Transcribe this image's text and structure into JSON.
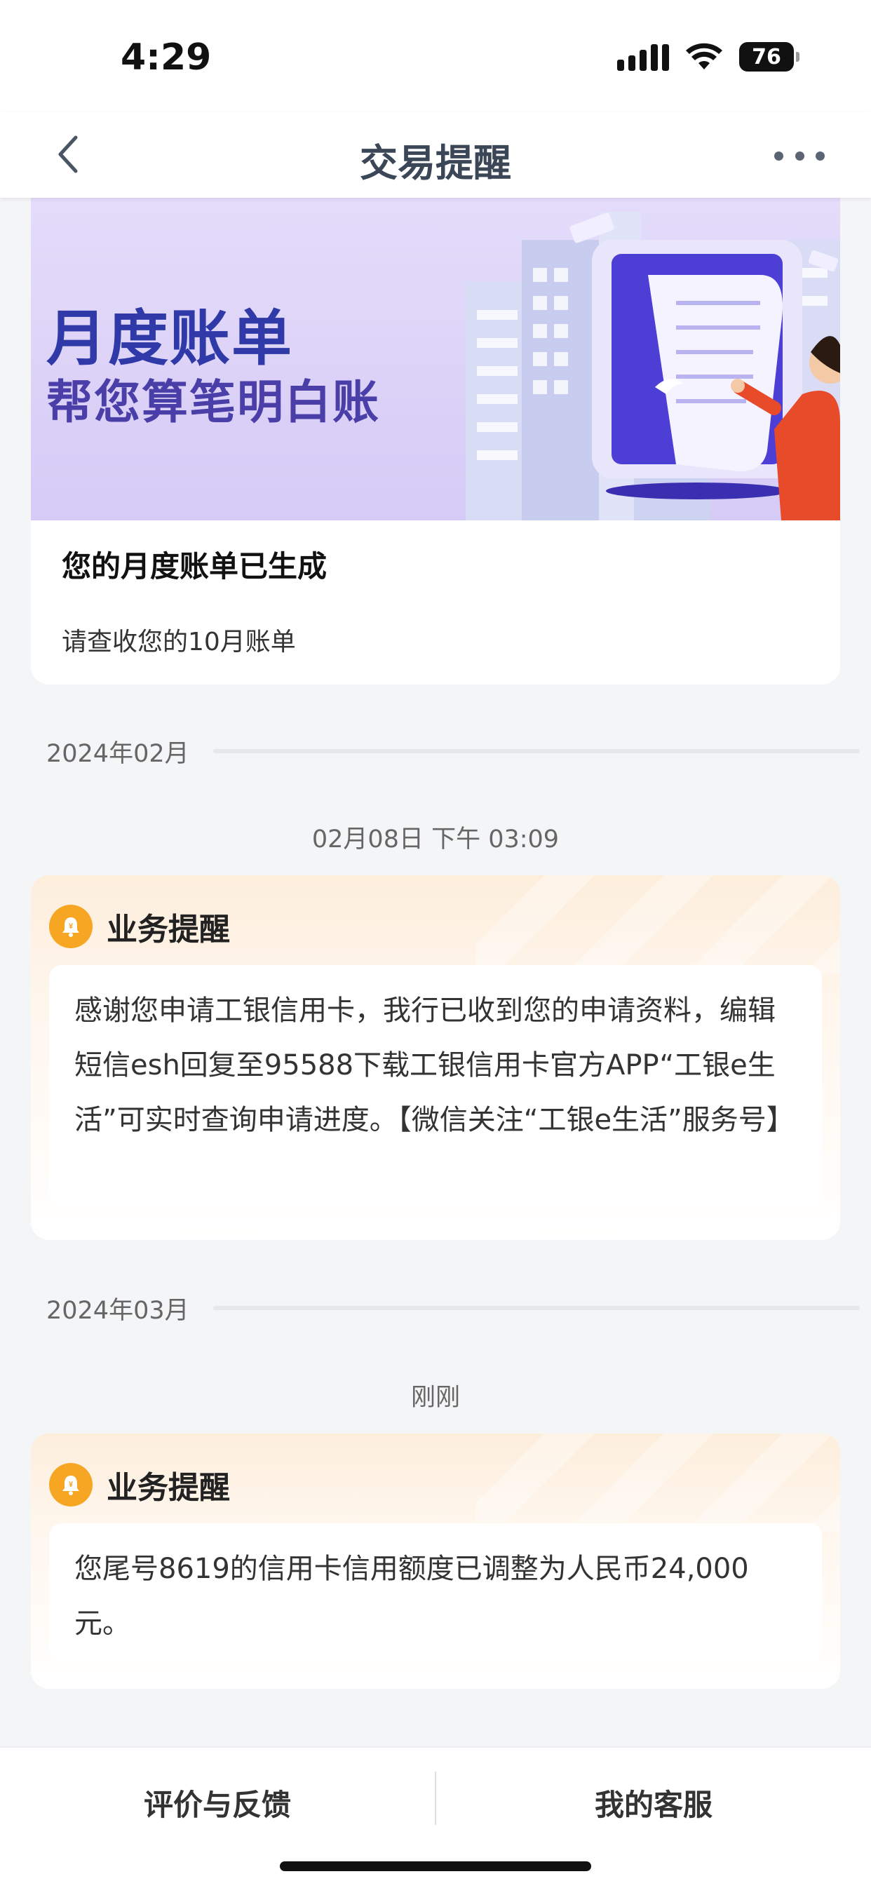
{
  "status_bar": {
    "time": "4:29",
    "battery": "76"
  },
  "nav": {
    "title": "交易提醒",
    "back_icon": "chevron-left-icon",
    "more_icon": "more-icon"
  },
  "bill_card": {
    "banner_title": "月度账单",
    "banner_subtitle": "帮您算笔明白账",
    "title": "您的月度账单已生成",
    "description": "请查收您的10月账单"
  },
  "sections": [
    {
      "month": "2024年02月",
      "time": "02月08日 下午 03:09",
      "notice_title": "业务提醒",
      "notice_body": "感谢您申请工银信用卡，我行已收到您的申请资料，编辑短信esh回复至95588下载工银信用卡官方APP“工银e生活”可实时查询申请进度。【微信关注“工银e生活”服务号】"
    },
    {
      "month": "2024年03月",
      "time": "刚刚",
      "notice_title": "业务提醒",
      "notice_body": "您尾号8619的信用卡信用额度已调整为人民币24,000元。"
    }
  ],
  "bottom_bar": {
    "feedback": "评价与反馈",
    "service": "我的客服"
  },
  "colors": {
    "accent": "#f6a623",
    "nav_title": "#3b4656",
    "banner": "#d6cbf6"
  }
}
